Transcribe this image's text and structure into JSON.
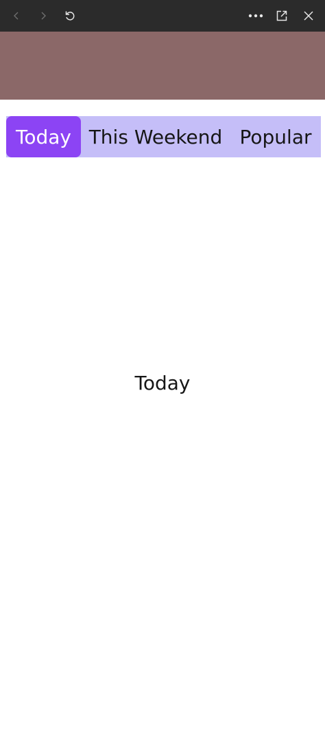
{
  "browser": {
    "icons": [
      "chevron-left-icon",
      "chevron-right-icon",
      "reload-icon",
      "more-icon",
      "open-external-icon",
      "close-icon"
    ]
  },
  "colors": {
    "toolbar": "#2b2b2b",
    "banner": "#8b6868",
    "tab_bar": "#c5bef8",
    "tab_active": "#8c44f4"
  },
  "tabs": [
    {
      "label": "Today",
      "active": true
    },
    {
      "label": "This Weekend",
      "active": false
    },
    {
      "label": "Popular",
      "active": false
    }
  ],
  "content": {
    "text": "Today"
  }
}
